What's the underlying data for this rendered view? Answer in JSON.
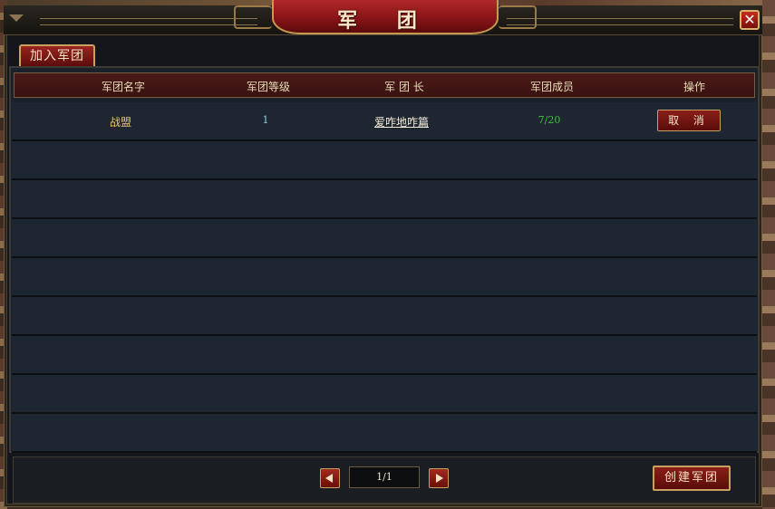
{
  "window": {
    "title": "军 团",
    "close_label": "✕"
  },
  "tabs": [
    {
      "label": "加入军团"
    }
  ],
  "table": {
    "headers": [
      "军团名字",
      "军团等级",
      "军 团 长",
      "军团成员",
      "操作"
    ],
    "rows": [
      {
        "name": "战盟",
        "level": "1",
        "leader": "爱咋地咋篇",
        "members": "7/20",
        "action_label": "取 消"
      }
    ]
  },
  "pagination": {
    "page_text": "1/1"
  },
  "footer": {
    "create_label": "创建军团"
  },
  "colors": {
    "title_plate": "#8a1416",
    "header_row": "#4a1a18",
    "row_bg": "#1e2731",
    "guild_name": "#f0c070",
    "members": "#40c040",
    "level": "#8ad0e0"
  },
  "icons": {
    "close": "close-icon",
    "prev": "arrow-left-icon",
    "next": "arrow-right-icon"
  }
}
